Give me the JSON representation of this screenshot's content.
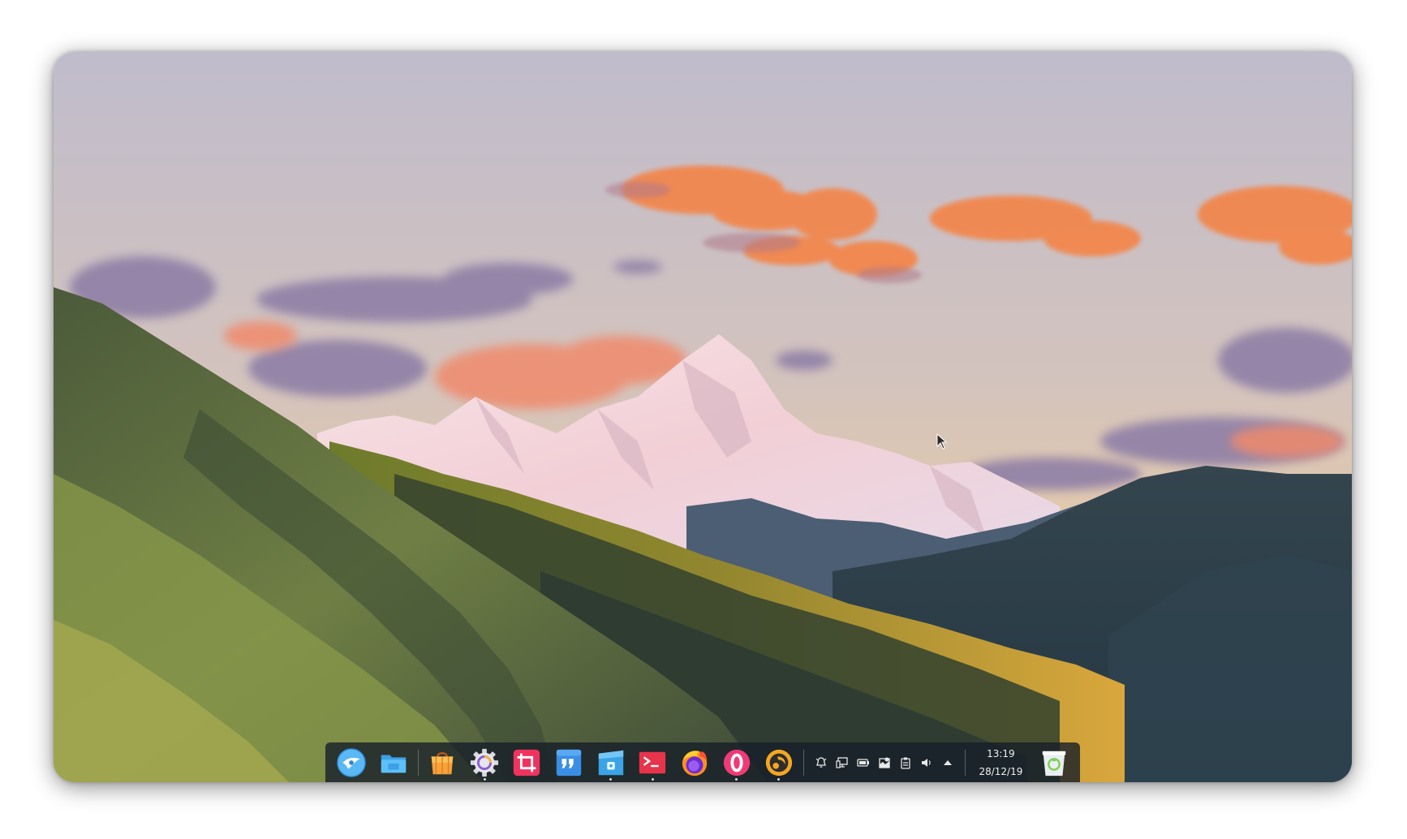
{
  "dock": {
    "apps": [
      {
        "name": "launcher",
        "icon": "launcher-icon",
        "running": false
      },
      {
        "name": "file-manager",
        "icon": "folder-icon",
        "running": false
      },
      {
        "name": "app-store",
        "icon": "shopping-bag-icon",
        "running": false
      },
      {
        "name": "settings",
        "icon": "gear-icon",
        "running": true
      },
      {
        "name": "screenshot",
        "icon": "crop-icon",
        "running": false
      },
      {
        "name": "quotes-app",
        "icon": "quote-icon",
        "running": false
      },
      {
        "name": "archive-manager",
        "icon": "archive-icon",
        "running": true
      },
      {
        "name": "terminal",
        "icon": "terminal-icon",
        "running": true
      },
      {
        "name": "firefox",
        "icon": "firefox-icon",
        "running": false
      },
      {
        "name": "opera",
        "icon": "opera-icon",
        "running": true
      },
      {
        "name": "music-player",
        "icon": "music-player-icon",
        "running": true
      }
    ],
    "tray": [
      "bell-icon",
      "network-icon",
      "battery-icon",
      "notification-icon",
      "clipboard-icon",
      "volume-icon",
      "expand-up-icon"
    ],
    "clock": {
      "time": "13:19",
      "date": "28/12/19"
    },
    "trash": "trash-icon"
  },
  "colors": {
    "dock_bg": "#161e28",
    "sky_top": "#c3c0cf",
    "sky_bottom": "#e2c8a9",
    "cloud_orange": "#f3894f",
    "cloud_purple": "#9b86a8"
  }
}
